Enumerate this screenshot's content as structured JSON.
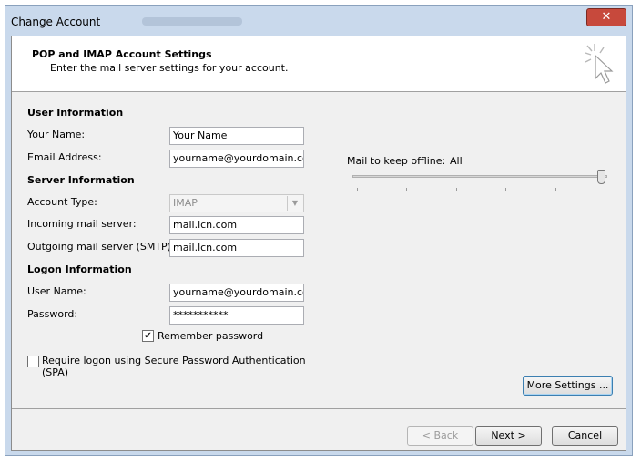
{
  "window": {
    "title": "Change Account",
    "close_label": "✕"
  },
  "header": {
    "title": "POP and IMAP Account Settings",
    "subtitle": "Enter the mail server settings for your account."
  },
  "user_info": {
    "section_label": "User Information",
    "name_label": "Your Name:",
    "name_value": "Your Name",
    "email_label": "Email Address:",
    "email_value": "yourname@yourdomain.com"
  },
  "server_info": {
    "section_label": "Server Information",
    "account_type_label": "Account Type:",
    "account_type_value": "IMAP",
    "incoming_label": "Incoming mail server:",
    "incoming_value": "mail.lcn.com",
    "outgoing_label": "Outgoing mail server (SMTP):",
    "outgoing_value": "mail.lcn.com"
  },
  "logon_info": {
    "section_label": "Logon Information",
    "username_label": "User Name:",
    "username_value": "yourname@yourdomain.com",
    "password_label": "Password:",
    "password_value": "***********",
    "remember_label": "Remember password",
    "remember_checked": true,
    "spa_label_line1": "Require logon using Secure Password Authentication",
    "spa_label_line2": "(SPA)",
    "spa_checked": false
  },
  "offline": {
    "label": "Mail to keep offline:",
    "value": "All",
    "slider_fraction": 1.0
  },
  "buttons": {
    "more_settings": "More Settings ...",
    "back": "< Back",
    "next": "Next >",
    "cancel": "Cancel"
  }
}
